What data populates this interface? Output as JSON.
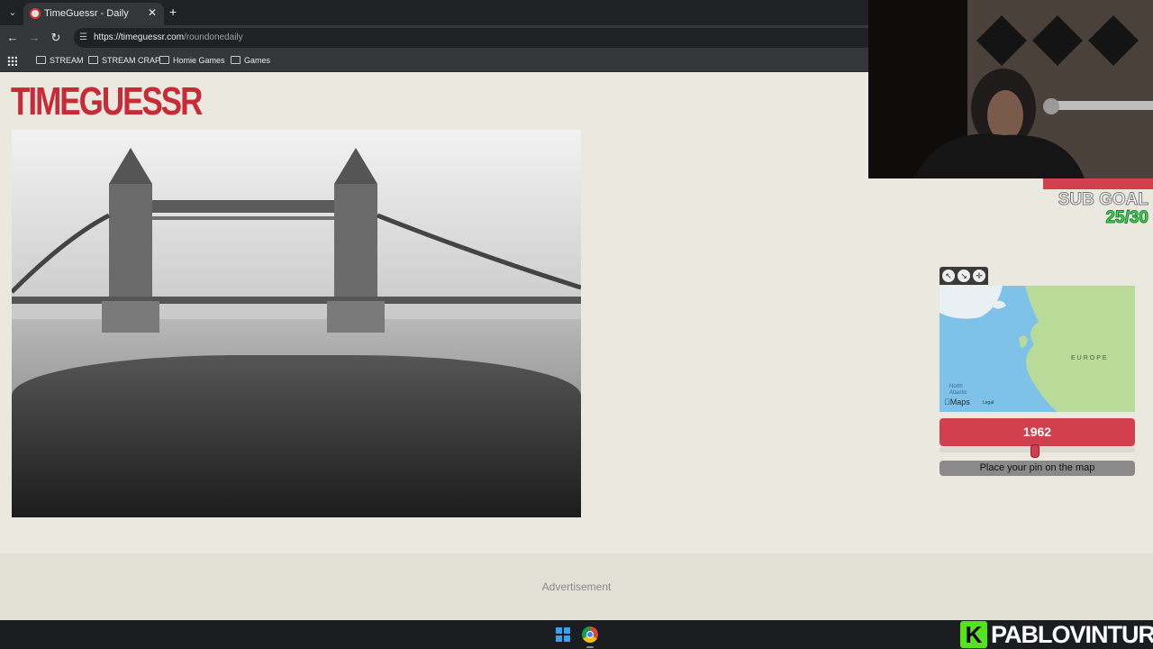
{
  "browser": {
    "tab_title": "TimeGuessr - Daily",
    "new_tab": "+",
    "tab_close": "✕",
    "url_host": "https://timeguessr.com",
    "url_path": "/roundonedaily",
    "bookmarks": [
      "STREAM",
      "STREAM CRAP",
      "Homie Games",
      "Games"
    ]
  },
  "page": {
    "logo": "TIMEGUESSR",
    "advertisement": "Advertisement"
  },
  "map": {
    "tools": [
      "↖",
      "↘",
      "✛"
    ],
    "continent_label": "EUROPE",
    "ocean_label_line1": "North",
    "ocean_label_line2": "Atlantic",
    "attribution": "Maps",
    "legal": "Legal"
  },
  "guess": {
    "year": "1962",
    "year_fraction": 0.49,
    "pin_prompt": "Place your pin on the map"
  },
  "stream": {
    "sub_goal_label": "SUB GOAL",
    "sub_goal_count": "25/30",
    "brand_logo_letter": "K",
    "brand_name": "PABLOVINTURA"
  },
  "icons": {
    "tab_menu": "chevron-down-icon",
    "back": "back-arrow-icon",
    "forward": "forward-arrow-icon",
    "reload": "reload-icon"
  },
  "colors": {
    "brand_red": "#d3404d",
    "page_bg": "#ebe9df",
    "goal_green": "#3ce05a"
  }
}
